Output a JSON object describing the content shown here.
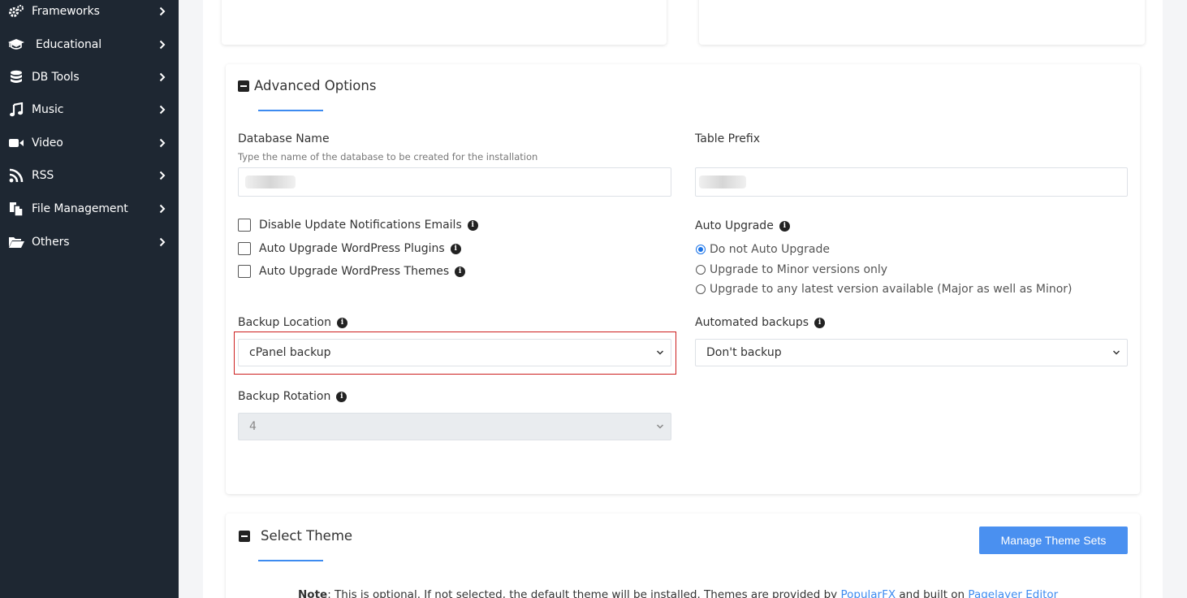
{
  "sidebar": {
    "items": [
      {
        "label": "Frameworks",
        "icon": "gears-icon"
      },
      {
        "label": "Educational",
        "icon": "graduation-cap-icon"
      },
      {
        "label": "DB Tools",
        "icon": "database-icon"
      },
      {
        "label": "Music",
        "icon": "music-icon"
      },
      {
        "label": "Video",
        "icon": "video-camera-icon"
      },
      {
        "label": "RSS",
        "icon": "rss-icon"
      },
      {
        "label": "File Management",
        "icon": "files-icon"
      },
      {
        "label": "Others",
        "icon": "folder-open-icon"
      }
    ]
  },
  "advanced": {
    "title": "Advanced Options",
    "db_name_label": "Database Name",
    "db_name_help": "Type the name of the database to be created for the installation",
    "table_prefix_label": "Table Prefix",
    "checkboxes": [
      "Disable Update Notifications Emails",
      "Auto Upgrade WordPress Plugins",
      "Auto Upgrade WordPress Themes"
    ],
    "auto_upgrade_label": "Auto Upgrade",
    "auto_upgrade_options": [
      "Do not Auto Upgrade",
      "Upgrade to Minor versions only",
      "Upgrade to any latest version available (Major as well as Minor)"
    ],
    "backup_location_label": "Backup Location",
    "backup_location_value": "cPanel backup",
    "automated_backups_label": "Automated backups",
    "automated_backups_value": "Don't backup",
    "backup_rotation_label": "Backup Rotation",
    "backup_rotation_value": "4"
  },
  "theme": {
    "title": "Select Theme",
    "manage_button": "Manage Theme Sets",
    "note_bold": "Note",
    "note_text_1": ": This is optional. If not selected, the default theme will be installed. Themes are provided by ",
    "note_link_1": "PopularFX",
    "note_text_2": " and built on ",
    "note_link_2": "Pagelayer Editor"
  },
  "colors": {
    "sidebar_bg": "#1e2732",
    "accent": "#3d8bf0",
    "button": "#4a90f0",
    "highlight": "#cc1f1f"
  }
}
